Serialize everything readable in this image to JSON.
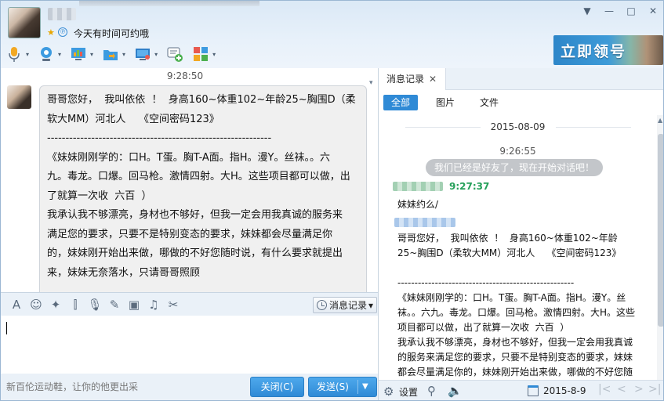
{
  "header": {
    "signature": "今天有时间可约哦",
    "star_glyph": "★",
    "badge_glyph": "℗"
  },
  "window_controls": {
    "collapse": "▼",
    "minimize": "—",
    "maximize": "□",
    "close": "✕"
  },
  "toolbar": {
    "icons": [
      "microphone-icon",
      "webcam-icon",
      "screen-share-icon",
      "send-file-icon",
      "remote-desktop-icon",
      "new-message-icon",
      "apps-icon"
    ],
    "dropdown_glyph": "▾"
  },
  "ad_banner": {
    "label": "立即领号"
  },
  "chat": {
    "time": "9:28:50",
    "collapse_glyph": "▾",
    "message_lines": [
      "哥哥您好，  我叫依依  ！  身高160~体重102~年龄25~胸围D（柔",
      "软大MM）河北人    《空间密码123》",
      "",
      "-------------------------------------------------------------",
      "《妹妹刚刚学的：口H。T蛋。胸T-A面。指H。漫Y。丝袜。。六",
      "九。毒龙。口爆。回马枪。激情四射。大H。这些项目都可以做，出",
      "了就算一次收  六百  ）",
      "我承认我不够漂亮，身材也不够好，但我一定会用我真诚的服务来",
      "满足您的要求，只要不是特别变态的要求，妹妹都会尽量满足你",
      "的，妹妹刚开始出来做，哪做的不好您随时说，有什么要求就提出",
      "来，妹妹无奈落水，只请哥哥照顾"
    ]
  },
  "input_toolbar": {
    "icons": [
      {
        "name": "font-icon",
        "glyph": "A"
      },
      {
        "name": "emoji-icon",
        "glyph": "☺"
      },
      {
        "name": "magic-expression-icon",
        "glyph": "✦"
      },
      {
        "name": "shake-icon",
        "glyph": "⫿"
      },
      {
        "name": "voice-message-icon",
        "glyph": "🎙"
      },
      {
        "name": "handwriting-icon",
        "glyph": "✎"
      },
      {
        "name": "image-icon",
        "glyph": "▣"
      },
      {
        "name": "music-icon",
        "glyph": "♫"
      },
      {
        "name": "screenshot-icon",
        "glyph": "✂"
      }
    ],
    "message_record_label": "消息记录",
    "dropdown_glyph": "▾"
  },
  "bottom": {
    "ad_text": "新百伦运动鞋，让你的他更出采",
    "close_label": "关闭(C)",
    "send_label": "发送(S)",
    "send_dropdown_glyph": "▼"
  },
  "history": {
    "tab_label": "消息记录",
    "tab_close": "✕",
    "filters": [
      "全部",
      "图片",
      "文件"
    ],
    "date": "2015-08-09",
    "time": "9:26:55",
    "system_message": "我们已经是好友了，现在开始对话吧！",
    "sender_time": "9:27:37",
    "message1": "妹妹约么/",
    "message2": "哥哥您好，  我叫依依  ！  身高160~体重102~年龄25~胸围D（柔软大MM）河北人    《空间密码123》\n\n----------------------------------------------------\n《妹妹刚刚学的：口H。T蛋。胸T-A面。指H。漫Y。丝袜。。六九。毒龙。口爆。回马枪。激情四射。大H。这些项目都可以做，出了就算一次收  六百  ）\n我承认我不够漂亮，身材也不够好，但我一定会用我真诚的服务来满足您的要求，只要不是特别变态的要求，妹妹都会尽量满足你的，妹妹刚开始出来做，哪做的不好您随时说，有什么要求就提出来，妹妹无奈落水，只请哥哥照",
    "scroll_up": "▲",
    "bottom": {
      "settings_label": "设置",
      "settings_glyph": "⚙",
      "find_glyph": "⚲",
      "sound_glyph": "🔈",
      "date": "2015-8-9",
      "nav": [
        "|<",
        "<",
        ">",
        ">|"
      ]
    }
  },
  "colors": {
    "accent": "#2f8ad6",
    "sender_time": "#26a05a",
    "window_bg": "#eaf1f8"
  }
}
